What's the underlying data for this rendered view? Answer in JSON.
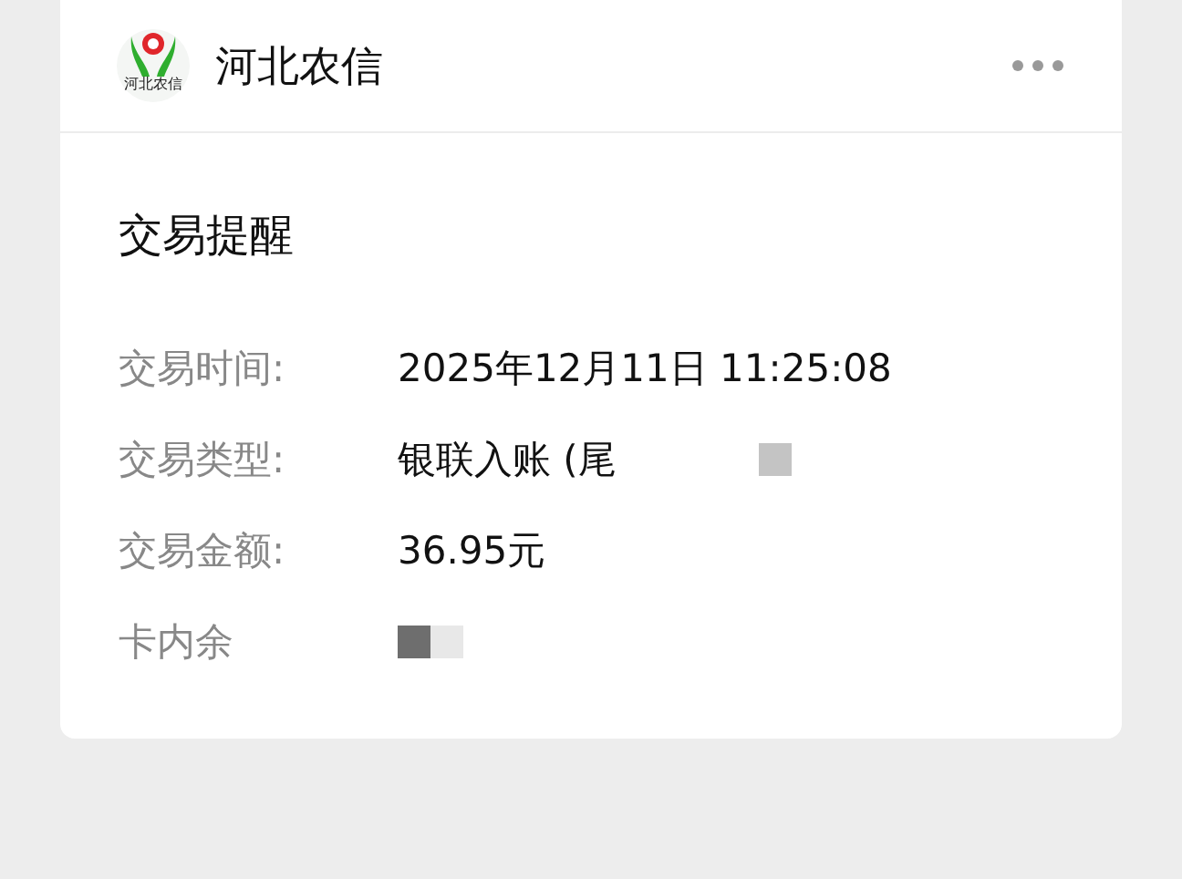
{
  "header": {
    "account_name": "河北农信",
    "logo_text": "河北农信"
  },
  "message": {
    "title": "交易提醒",
    "rows": [
      {
        "label": "交易时间:",
        "value": "2025年12月11日 11:25:08",
        "masked": false
      },
      {
        "label": "交易类型:",
        "value": "银联入账 (尾",
        "masked": true
      },
      {
        "label": "交易金额:",
        "value": "36.95元",
        "masked": false
      },
      {
        "label": "卡内余",
        "value": "",
        "masked": true
      }
    ]
  }
}
